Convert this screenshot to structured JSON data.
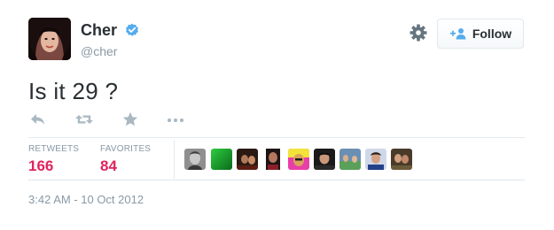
{
  "author": {
    "display_name": "Cher",
    "screen_name": "@cher",
    "verified": true,
    "avatar": "avatar"
  },
  "header": {
    "settings_icon": "gear-icon",
    "follow_label": "Follow",
    "follow_icon": "add-user-icon"
  },
  "tweet": {
    "text": "Is it 29 ?",
    "timestamp": "3:42 AM - 10 Oct 2012"
  },
  "actions": [
    {
      "name": "reply",
      "icon": "reply-icon"
    },
    {
      "name": "retweet",
      "icon": "retweet-icon"
    },
    {
      "name": "favorite",
      "icon": "star-icon"
    },
    {
      "name": "more",
      "icon": "more-icon"
    }
  ],
  "stats": {
    "retweets_label": "RETWEETS",
    "retweets_count": "166",
    "favorites_label": "FAVORITES",
    "favorites_count": "84"
  },
  "favorited_by_count": 9,
  "colors": {
    "text": "#292f33",
    "muted": "#8899a6",
    "count": "#e0245e",
    "verified": "#55acee",
    "divider": "#e1e8ed",
    "icon": "#aab8c2"
  }
}
